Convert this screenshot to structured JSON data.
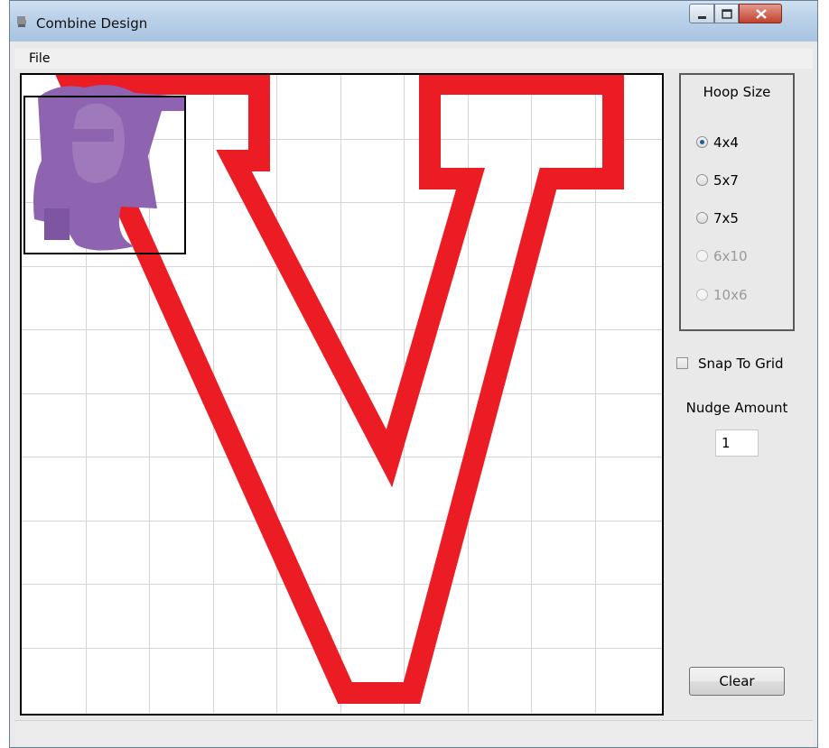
{
  "window": {
    "title": "Combine Design"
  },
  "menu": {
    "file_label": "File"
  },
  "hoop": {
    "title": "Hoop Size",
    "options": [
      {
        "label": "4x4",
        "selected": true,
        "enabled": true
      },
      {
        "label": "5x7",
        "selected": false,
        "enabled": true
      },
      {
        "label": "7x5",
        "selected": false,
        "enabled": true
      },
      {
        "label": "6x10",
        "selected": false,
        "enabled": false
      },
      {
        "label": "10x6",
        "selected": false,
        "enabled": false
      }
    ]
  },
  "snap": {
    "label": "Snap To Grid",
    "checked": false
  },
  "nudge": {
    "label": "Nudge Amount",
    "value": "1"
  },
  "clear": {
    "label": "Clear"
  },
  "colors": {
    "red_design": "#ec1c24",
    "purple_design": "#8e63b0",
    "grid": "#d4d4d4",
    "hoop_outline": "#000000"
  }
}
